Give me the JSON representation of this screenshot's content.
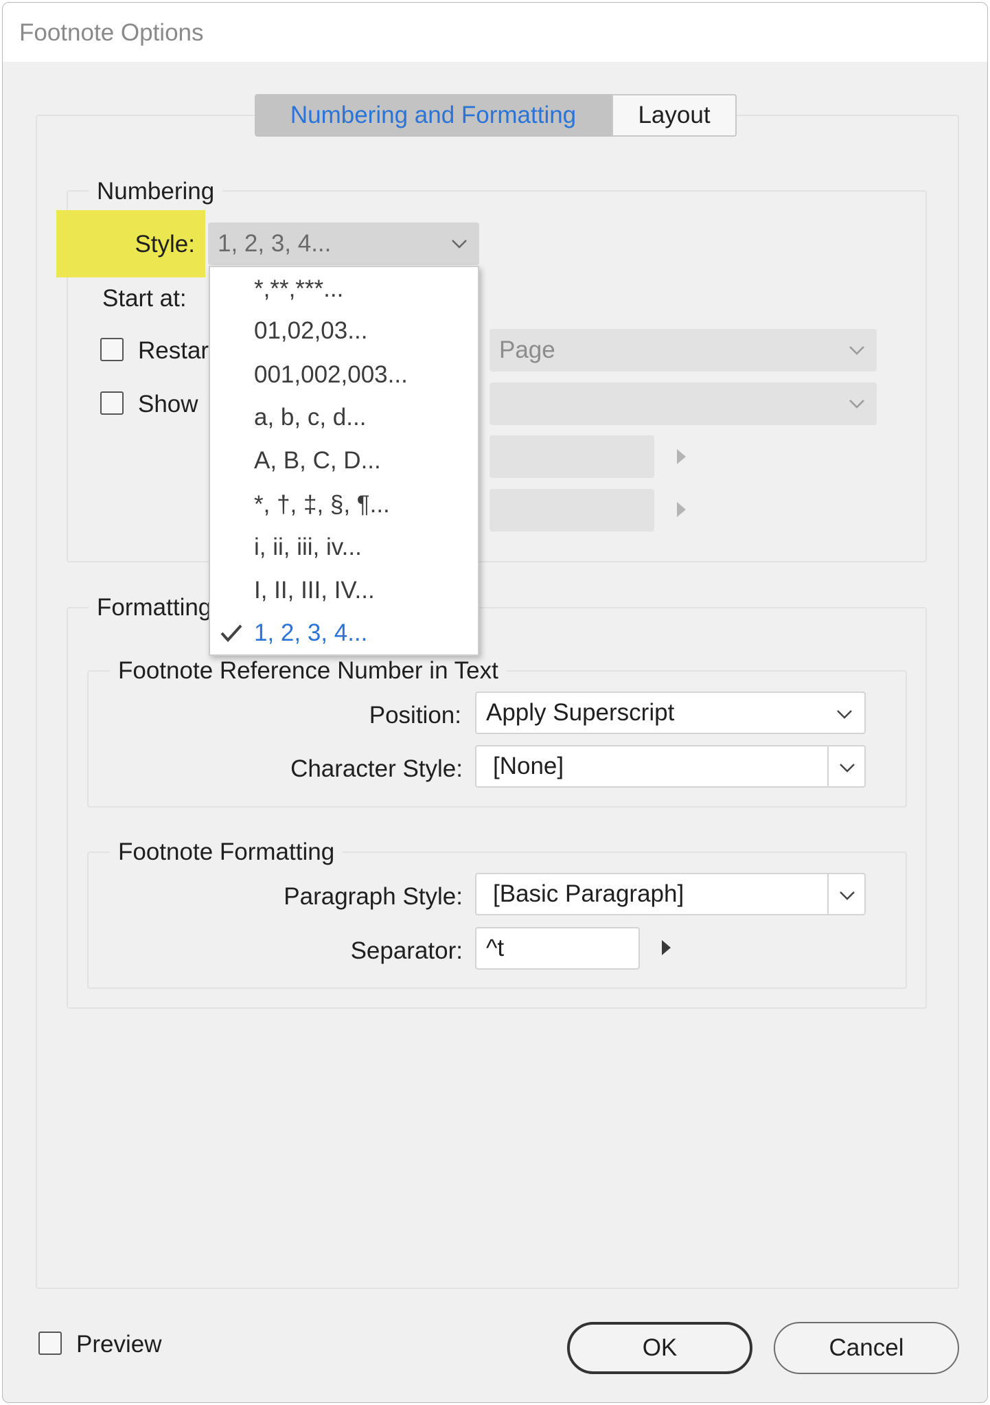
{
  "window": {
    "title": "Footnote Options"
  },
  "tabs": [
    {
      "label": "Numbering and Formatting",
      "active": true
    },
    {
      "label": "Layout",
      "active": false
    }
  ],
  "numbering": {
    "group_label": "Numbering",
    "style_label": "Style:",
    "style_value": "1, 2, 3, 4...",
    "start_at_label": "Start at:",
    "restart_label": "Restar",
    "show_label": "Show",
    "restart_scope_value": "Page",
    "style_options": [
      "*,**,***...",
      "01,02,03...",
      "001,002,003...",
      "a, b, c, d...",
      "A, B, C, D...",
      "*, †, ‡, §, ¶...",
      "i, ii, iii, iv...",
      "I, II, III, IV...",
      "1, 2, 3, 4..."
    ],
    "selected_option_index": 8
  },
  "formatting": {
    "group_label": "Formatting",
    "reference": {
      "group_label": "Footnote Reference Number in Text",
      "position_label": "Position:",
      "position_value": "Apply Superscript",
      "char_style_label": "Character Style:",
      "char_style_value": "[None]"
    },
    "footnote": {
      "group_label": "Footnote Formatting",
      "para_style_label": "Paragraph Style:",
      "para_style_value": "[Basic Paragraph]",
      "separator_label": "Separator:",
      "separator_value": "^t"
    }
  },
  "footer": {
    "preview_label": "Preview",
    "ok_label": "OK",
    "cancel_label": "Cancel"
  },
  "colors": {
    "accent": "#2a74d8",
    "highlight": "#ece651",
    "dialog_bg": "#f0f0f0"
  }
}
